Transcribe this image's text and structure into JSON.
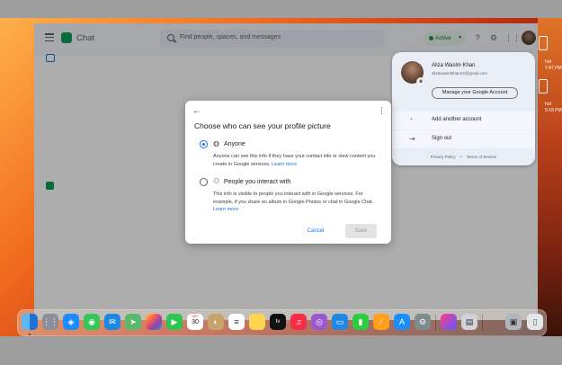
{
  "app": {
    "title": "Chat",
    "search_placeholder": "Find people, spaces, and messages",
    "status_label": "Active",
    "status_color": "#1e8e3e",
    "brand_color": "#0f9d58",
    "icons": [
      "menu-icon",
      "chat-logo-icon",
      "search-icon",
      "help-icon",
      "settings-icon",
      "apps-grid-icon",
      "account-avatar"
    ]
  },
  "account": {
    "name": "Aliza Wasim Khan",
    "email": "alizawasimkhan12@gmail.com",
    "manage_label": "Manage your Google Account",
    "add_account_label": "Add another account",
    "sign_out_label": "Sign out",
    "footer_privacy": "Privacy Policy",
    "footer_sep": "•",
    "footer_terms": "Terms of Service"
  },
  "dialog": {
    "title": "Choose who can see your profile picture",
    "options": [
      {
        "label": "Anyone",
        "description": "Anyone can see this info if they have your contact info or view content you create in Google services.",
        "link": "Learn more",
        "selected": true,
        "icon": "globe-icon"
      },
      {
        "label": "People you interact with",
        "description": "This info is visible to people you interact with in Google services. For example, if you share an album in Google Photos or chat in Google Chat.",
        "link": "Learn more",
        "selected": false,
        "icon": "people-icon"
      }
    ],
    "cancel_label": "Cancel",
    "save_label": "Save",
    "accent_color": "#1a73e8"
  },
  "desktop_widgets": [
    {
      "line1": "hot",
      "line2": "7:47 PM"
    },
    {
      "line1": "hot",
      "line2": "5:18 PM"
    }
  ],
  "dock": {
    "calendar_month": "SEP",
    "calendar_day": "30",
    "apps": [
      "finder",
      "launchpad",
      "safari",
      "messages",
      "mail",
      "maps",
      "photos",
      "facetime",
      "calendar",
      "contacts",
      "reminders",
      "notes",
      "apple-tv",
      "music",
      "podcasts",
      "keynote",
      "numbers",
      "pages",
      "app-store",
      "system-preferences",
      "shortcuts",
      "preview",
      "screenshot",
      "trash"
    ]
  }
}
